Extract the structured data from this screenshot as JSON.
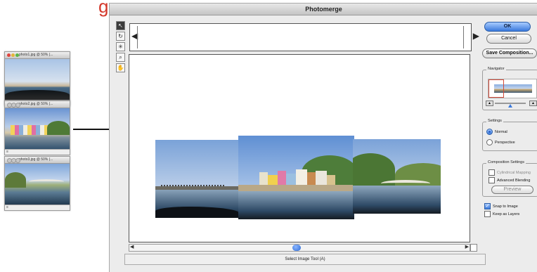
{
  "dialog": {
    "title": "Photomerge",
    "status_text": "Select Image Tool (A)"
  },
  "tools": [
    {
      "name": "select-image-tool-icon",
      "glyph": "↖",
      "active": true
    },
    {
      "name": "rotate-image-tool-icon",
      "glyph": "↻",
      "active": false
    },
    {
      "name": "set-vanishing-point-tool-icon",
      "glyph": "⊹",
      "active": false
    },
    {
      "name": "zoom-tool-icon",
      "glyph": "🔍",
      "active": false
    },
    {
      "name": "hand-tool-icon",
      "glyph": "✋",
      "active": false
    }
  ],
  "buttons": {
    "ok": "OK",
    "cancel": "Cancel",
    "save_composition": "Save Composition...",
    "preview": "Preview"
  },
  "navigator": {
    "label": "Navigator"
  },
  "settings": {
    "label": "Settings",
    "normal": "Normal",
    "perspective": "Perspective",
    "selected": "Normal"
  },
  "composition_settings": {
    "label": "Composition Settings",
    "cylindrical_mapping": "Cylindrical Mapping",
    "advanced_blending": "Advanced Blending"
  },
  "options": {
    "snap_to_image": "Snap to Image",
    "keep_as_layers": "Keep as Layers",
    "snap_checked": true,
    "keep_checked": false
  },
  "thumbnail_windows": [
    {
      "title": "photo1.jpg @ 50% (..."
    },
    {
      "title": "photo2.jpg @ 50% (..."
    },
    {
      "title": "photo3.jpg @ 50% (..."
    }
  ]
}
